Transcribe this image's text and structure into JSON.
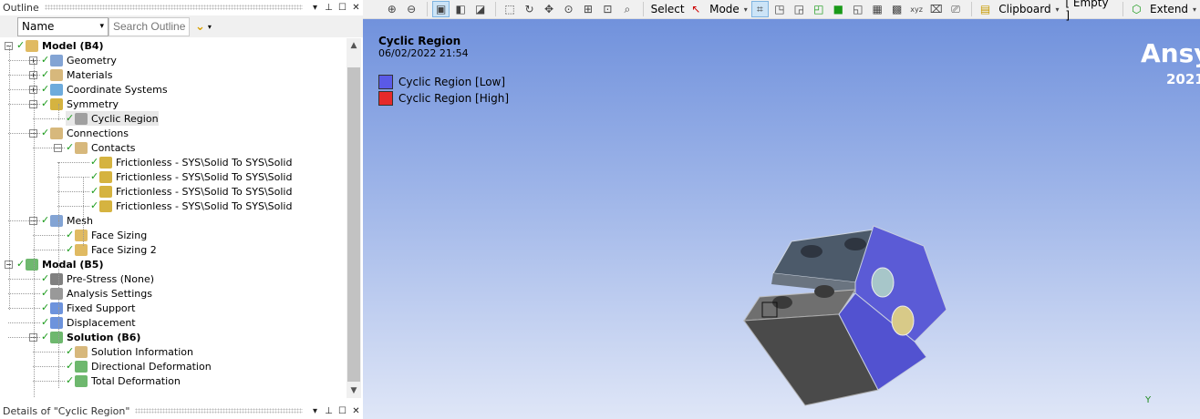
{
  "outline": {
    "title": "Outline",
    "filter_select": "Name",
    "search_placeholder": "Search Outline",
    "tree": [
      {
        "label": "Model (B4)",
        "bold": true
      },
      {
        "label": "Geometry"
      },
      {
        "label": "Materials"
      },
      {
        "label": "Coordinate Systems"
      },
      {
        "label": "Symmetry"
      },
      {
        "label": "Cyclic Region",
        "selected": true
      },
      {
        "label": "Connections"
      },
      {
        "label": "Contacts"
      },
      {
        "label": "Frictionless - SYS\\Solid To SYS\\Solid"
      },
      {
        "label": "Frictionless - SYS\\Solid To SYS\\Solid"
      },
      {
        "label": "Frictionless - SYS\\Solid To SYS\\Solid"
      },
      {
        "label": "Frictionless - SYS\\Solid To SYS\\Solid"
      },
      {
        "label": "Mesh"
      },
      {
        "label": "Face Sizing"
      },
      {
        "label": "Face Sizing 2"
      },
      {
        "label": "Modal (B5)",
        "bold": true
      },
      {
        "label": "Pre-Stress (None)"
      },
      {
        "label": "Analysis Settings"
      },
      {
        "label": "Fixed Support"
      },
      {
        "label": "Displacement"
      },
      {
        "label": "Solution (B6)",
        "bold": true
      },
      {
        "label": "Solution Information"
      },
      {
        "label": "Directional Deformation"
      },
      {
        "label": "Total Deformation"
      }
    ]
  },
  "details": {
    "title": "Details of \"Cyclic Region\""
  },
  "toolbar": {
    "select": "Select",
    "mode": "Mode",
    "clipboard": "Clipboard",
    "empty": "[ Empty ]",
    "extend": "Extend"
  },
  "viewport": {
    "title": "Cyclic Region",
    "date": "06/02/2022 21:54",
    "legend": [
      {
        "label": "Cyclic Region [Low]",
        "color": "#5a5ae6"
      },
      {
        "label": "Cyclic Region [High]",
        "color": "#e62a2a"
      }
    ],
    "brand": "Ansys",
    "version": "2021",
    "axis_y": "Y"
  }
}
